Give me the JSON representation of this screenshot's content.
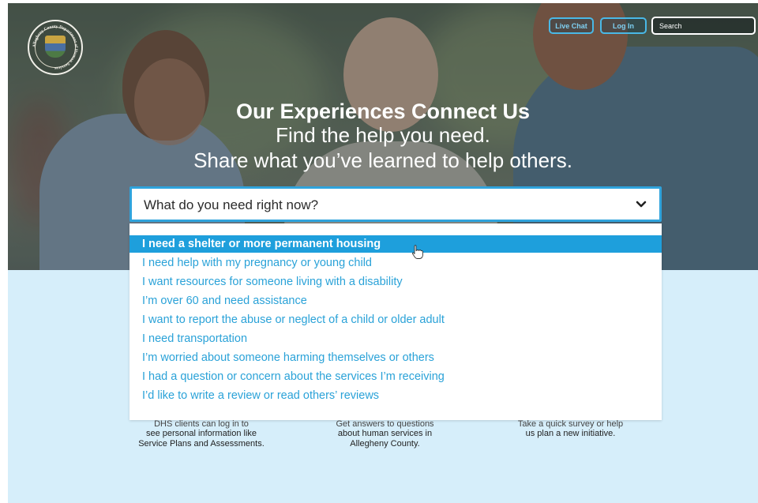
{
  "header": {
    "logo_text": "Allegheny County Department of Human Services",
    "live_chat_label": "Live Chat",
    "login_label": "Log In",
    "search_placeholder": "Search"
  },
  "hero": {
    "title": "Our Experiences Connect Us",
    "subtitle_line1": "Find the help you need.",
    "subtitle_line2": "Share what you’ve learned to help others."
  },
  "dropdown": {
    "placeholder": "What do you need right now?",
    "options": [
      "I need a shelter or more permanent housing",
      "I need help with my pregnancy or young child",
      "I want resources for someone living with a disability",
      "I’m over 60 and need assistance",
      "I want to report the abuse or neglect of a child or older adult",
      "I need transportation",
      "I’m worried about someone harming themselves or others",
      "I had a question or concern about the services I’m receiving",
      "I’d like to write a review or read others’ reviews"
    ],
    "highlighted_index": 0
  },
  "cards": [
    {
      "partial_line": "DHS clients can log in to",
      "text": "see personal information like Service Plans and Assessments."
    },
    {
      "partial_line": "Get answers to questions",
      "text": "about human services in Allegheny County."
    },
    {
      "partial_line": "Take a quick survey or help",
      "text": "us plan a new initiative."
    }
  ],
  "colors": {
    "accent": "#1e9fdc",
    "option_text": "#2aa2d8",
    "panel_bg": "#d6eefa"
  }
}
